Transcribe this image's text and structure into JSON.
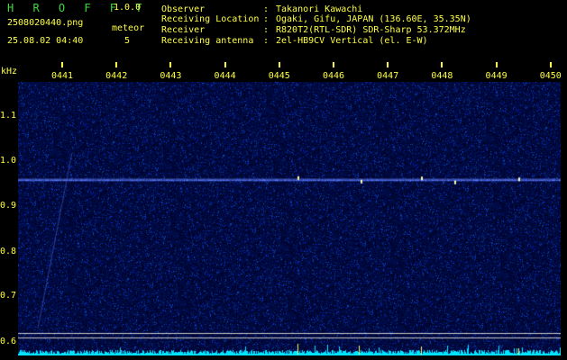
{
  "header": {
    "app_name": "H R O F F T",
    "version": "1.0.0",
    "filename": "2508020440.png",
    "timestamp": "25.08.02 04:40",
    "meteor_label": "meteor",
    "meteor_count": "5"
  },
  "station": {
    "rows": [
      {
        "label": "Observer",
        "value": "Takanori Kawachi"
      },
      {
        "label": "Receiving Location",
        "value": "Ogaki, Gifu, JAPAN (136.60E, 35.35N)"
      },
      {
        "label": "Receiver",
        "value": "R820T2(RTL-SDR) SDR-Sharp 53.372MHz"
      },
      {
        "label": "Receiving antenna",
        "value": "2el-HB9CV Vertical (el. E-W)"
      }
    ],
    "separator": ":"
  },
  "axes": {
    "y_unit": "kHz",
    "y_ticks": [
      "1.1",
      "1.0",
      "0.9",
      "0.8",
      "0.7",
      "0.6"
    ],
    "x_ticks": [
      "0441",
      "0442",
      "0443",
      "0444",
      "0445",
      "0446",
      "0447",
      "0448",
      "0449",
      "0450"
    ]
  },
  "spectrogram": {
    "y_range_khz": [
      0.59,
      1.15
    ],
    "carrier_khz": 0.958,
    "reference_lines_khz": [
      0.62,
      0.61
    ],
    "colors": {
      "background": "#000028",
      "noise": "#1a2a9a",
      "carrier": "#5577ff",
      "baseline": "#00e5ff",
      "labels": "#ffff44",
      "meteor_spike": "#ffffaa"
    }
  }
}
